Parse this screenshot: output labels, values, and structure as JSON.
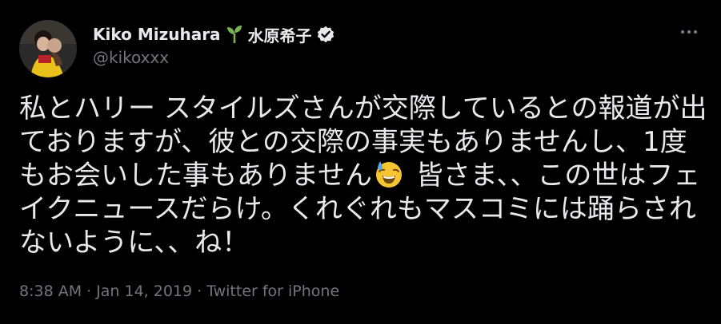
{
  "author": {
    "display_name": "Kiko Mizuhara",
    "name_jp": "水原希子",
    "handle": "@kikoxxx",
    "icons": [
      "sprout-icon",
      "verified-icon"
    ]
  },
  "tweet": {
    "text_part1": "私とハリー スタイルズさんが交際しているとの報道が出ておりますが、彼との交際の事実もありませんし、1度もお会いした事もありません",
    "emoji": "grinning-face-with-sweat-emoji",
    "text_part2": " 皆さま、、この世はフェイクニュースだらけ。くれぐれもマスコミには踊らされないように、、ね！"
  },
  "meta": {
    "time": "8:38 AM",
    "date": "Jan 14, 2019",
    "source": "Twitter for iPhone",
    "separator": "·"
  },
  "colors": {
    "background": "#000000",
    "text": "#e7e9ea",
    "muted": "#71767b",
    "sprout": "#77b255"
  }
}
